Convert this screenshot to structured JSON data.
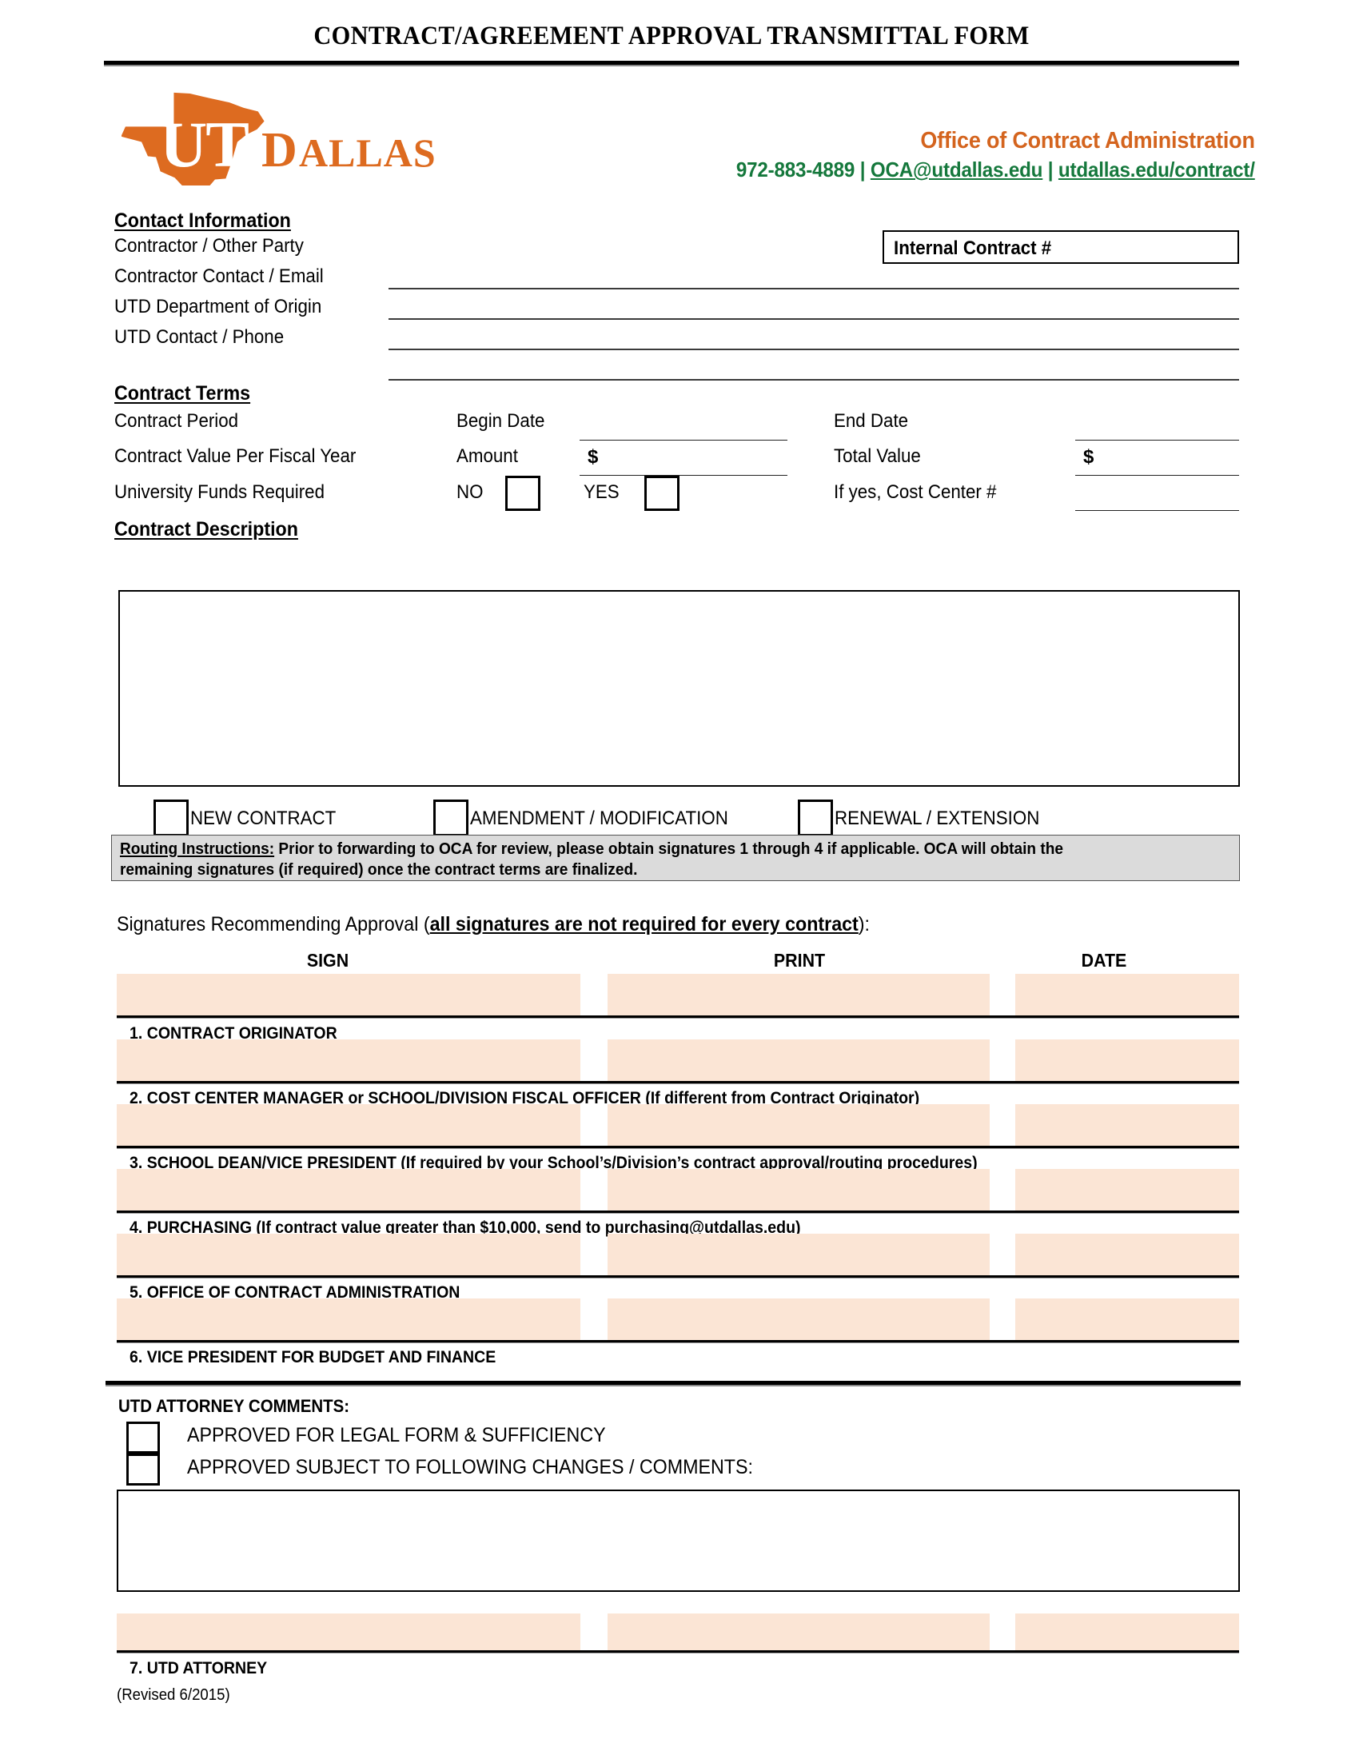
{
  "document": {
    "title": "CONTRACT/AGREEMENT APPROVAL TRANSMITTAL FORM",
    "revision": "(Revised 6/2015)"
  },
  "logo": {
    "alt": "UT DALLAS",
    "wordmark": "DALLAS",
    "knockout": "UT",
    "color": "#DD6B20"
  },
  "header": {
    "office": "Office of Contract Administration",
    "phone": "972-883-4889",
    "email": "OCA@utdallas.edu",
    "website": "utdallas.edu/contract/",
    "separator": " | ",
    "office_color": "#D4641E",
    "contact_color": "#15783C"
  },
  "internal_contract": {
    "label": "Internal Contract #",
    "value": ""
  },
  "contact_information": {
    "heading": "Contact Information",
    "fields": [
      {
        "label": "Contractor / Other Party",
        "value": ""
      },
      {
        "label": "Contractor Contact / Email",
        "value": ""
      },
      {
        "label": "UTD Department of Origin",
        "value": ""
      },
      {
        "label": "UTD Contact / Phone",
        "value": ""
      }
    ]
  },
  "contract_terms": {
    "heading": "Contract Terms",
    "rows": [
      {
        "label": "Contract Period",
        "mid_label": "Begin Date",
        "mid_value": "",
        "right_label": "End Date",
        "right_value": ""
      },
      {
        "label": "Contract Value Per Fiscal Year",
        "mid_label": "Amount",
        "mid_prefix": "$",
        "mid_value": "",
        "right_label": "Total Value",
        "right_prefix": "$",
        "right_value": ""
      },
      {
        "label": "University Funds Required",
        "no_label": "NO",
        "yes_label": "YES",
        "no_checked": false,
        "yes_checked": false,
        "right_label": "If yes, Cost Center #",
        "right_value": ""
      }
    ]
  },
  "contract_description": {
    "heading": "Contract Description",
    "value": ""
  },
  "contract_type": {
    "options": [
      {
        "label": "NEW CONTRACT",
        "checked": false
      },
      {
        "label": "AMENDMENT / MODIFICATION",
        "checked": false
      },
      {
        "label": "RENEWAL / EXTENSION",
        "checked": false
      }
    ]
  },
  "routing_instructions": {
    "title": "Routing Instructions:",
    "line1": " Prior to forwarding to OCA for review, please obtain signatures 1 through 4 if applicable.  OCA will obtain the",
    "line2": "remaining signatures (if required) once the contract terms are finalized.",
    "background": "#DBDBDB"
  },
  "signatures": {
    "intro_plain": "Signatures Recommending Approval (",
    "intro_underlined": "all signatures are not required for every contract",
    "intro_tail": "):",
    "columns": [
      "SIGN",
      "PRINT",
      "DATE"
    ],
    "fill_color": "#FBE5D5",
    "rows": [
      {
        "number": "1.",
        "label": "1. CONTRACT ORIGINATOR",
        "sign": "",
        "print": "",
        "date": ""
      },
      {
        "number": "2.",
        "label": "2. COST CENTER MANAGER or SCHOOL/DIVISION FISCAL OFFICER (If different from Contract Originator)",
        "sign": "",
        "print": "",
        "date": ""
      },
      {
        "number": "3.",
        "label": "3. SCHOOL DEAN/VICE PRESIDENT (If required by your School’s/Division’s contract approval/routing procedures)",
        "sign": "",
        "print": "",
        "date": ""
      },
      {
        "number": "4.",
        "label": "4. PURCHASING (If contract value greater than $10,000, send to purchasing@utdallas.edu)",
        "sign": "",
        "print": "",
        "date": ""
      },
      {
        "number": "5.",
        "label": "5. OFFICE OF CONTRACT ADMINISTRATION",
        "sign": "",
        "print": "",
        "date": ""
      },
      {
        "number": "6.",
        "label": "6. VICE PRESIDENT FOR BUDGET AND FINANCE",
        "sign": "",
        "print": "",
        "date": ""
      }
    ]
  },
  "attorney": {
    "heading": "UTD ATTORNEY COMMENTS:",
    "options": [
      {
        "label": "APPROVED FOR LEGAL FORM & SUFFICIENCY",
        "checked": false
      },
      {
        "label": "APPROVED SUBJECT TO FOLLOWING CHANGES / COMMENTS:",
        "checked": false
      }
    ],
    "comments_value": "",
    "signature_row": {
      "label": "7. UTD ATTORNEY",
      "sign": "",
      "print": "",
      "date": ""
    }
  }
}
